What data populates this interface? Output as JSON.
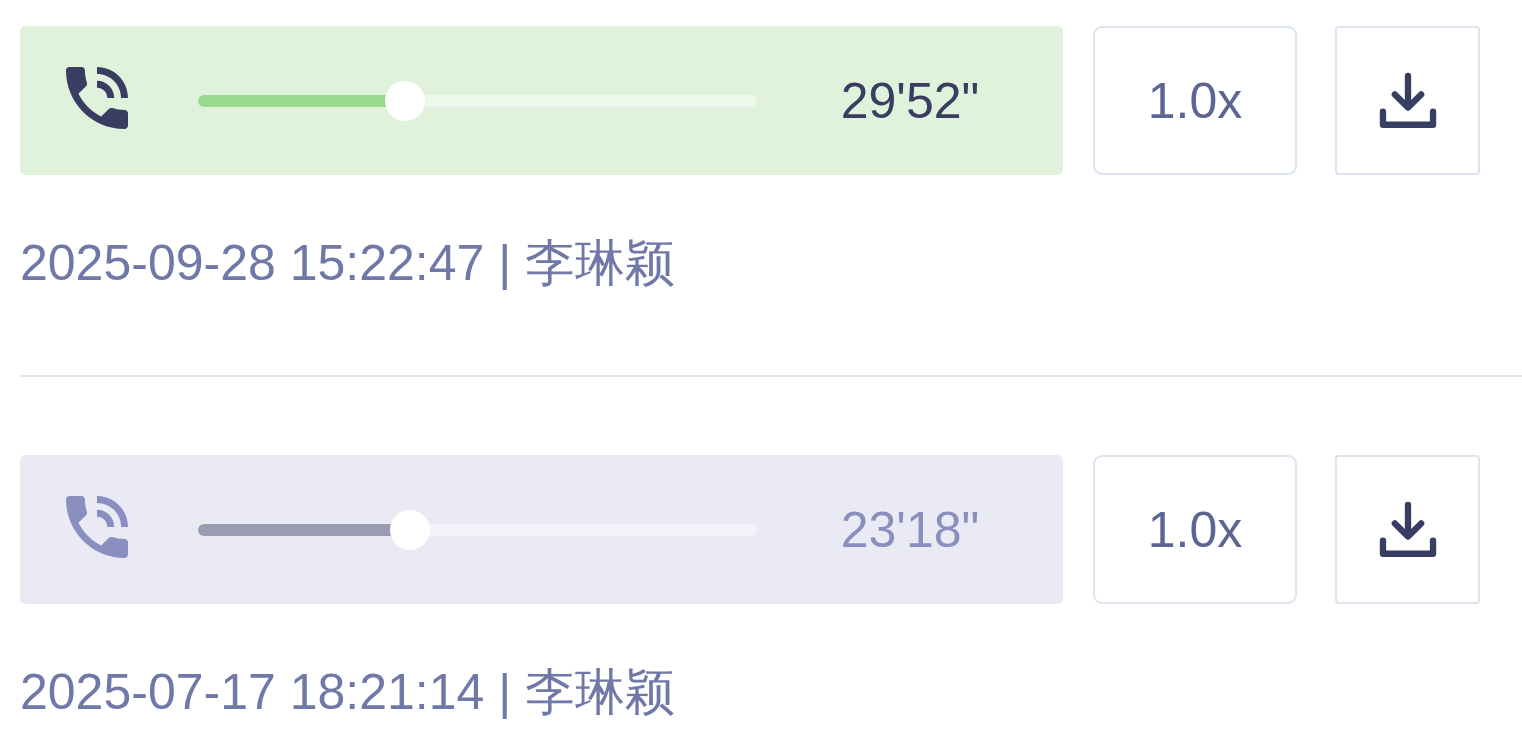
{
  "recordings": [
    {
      "active": true,
      "level": 0.37,
      "duration": "29'52\"",
      "speed": "1.0x",
      "info": "2025-09-28 15:22:47 | 李琳颖"
    },
    {
      "active": false,
      "level": 0.38,
      "duration": "23'18\"",
      "speed": "1.0x",
      "info": "2025-07-17 18:21:14 | 李琳颖"
    }
  ]
}
